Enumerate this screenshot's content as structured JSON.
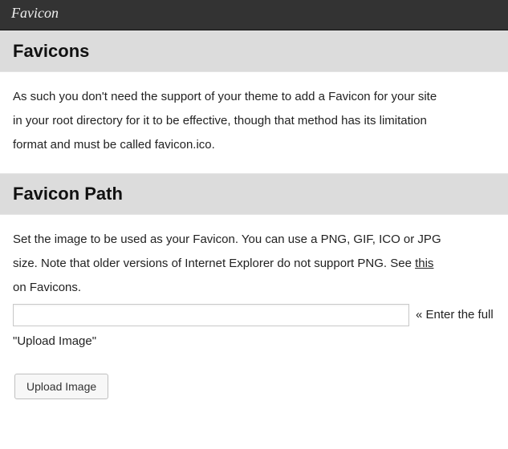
{
  "titlebar": {
    "title": "Favicon"
  },
  "sections": {
    "favicons": {
      "heading": "Favicons",
      "line1": "As such you don't need the support of your theme to add a Favicon for your site",
      "line2": "in your root directory for it to be effective, though that method has its limitation ",
      "line3": "format and must be called favicon.ico."
    },
    "favicon_path": {
      "heading": "Favicon Path",
      "line1": "Set the image to be used as your Favicon. You can use a PNG, GIF, ICO or JPG",
      "line2_a": "size. Note that older versions of Internet Explorer do not support PNG. See ",
      "line2_link": "this",
      "line3": "on Favicons.",
      "input_value": "",
      "input_hint": "« Enter the full",
      "quoted_line": "\"Upload Image\"",
      "upload_button": "Upload Image"
    }
  }
}
